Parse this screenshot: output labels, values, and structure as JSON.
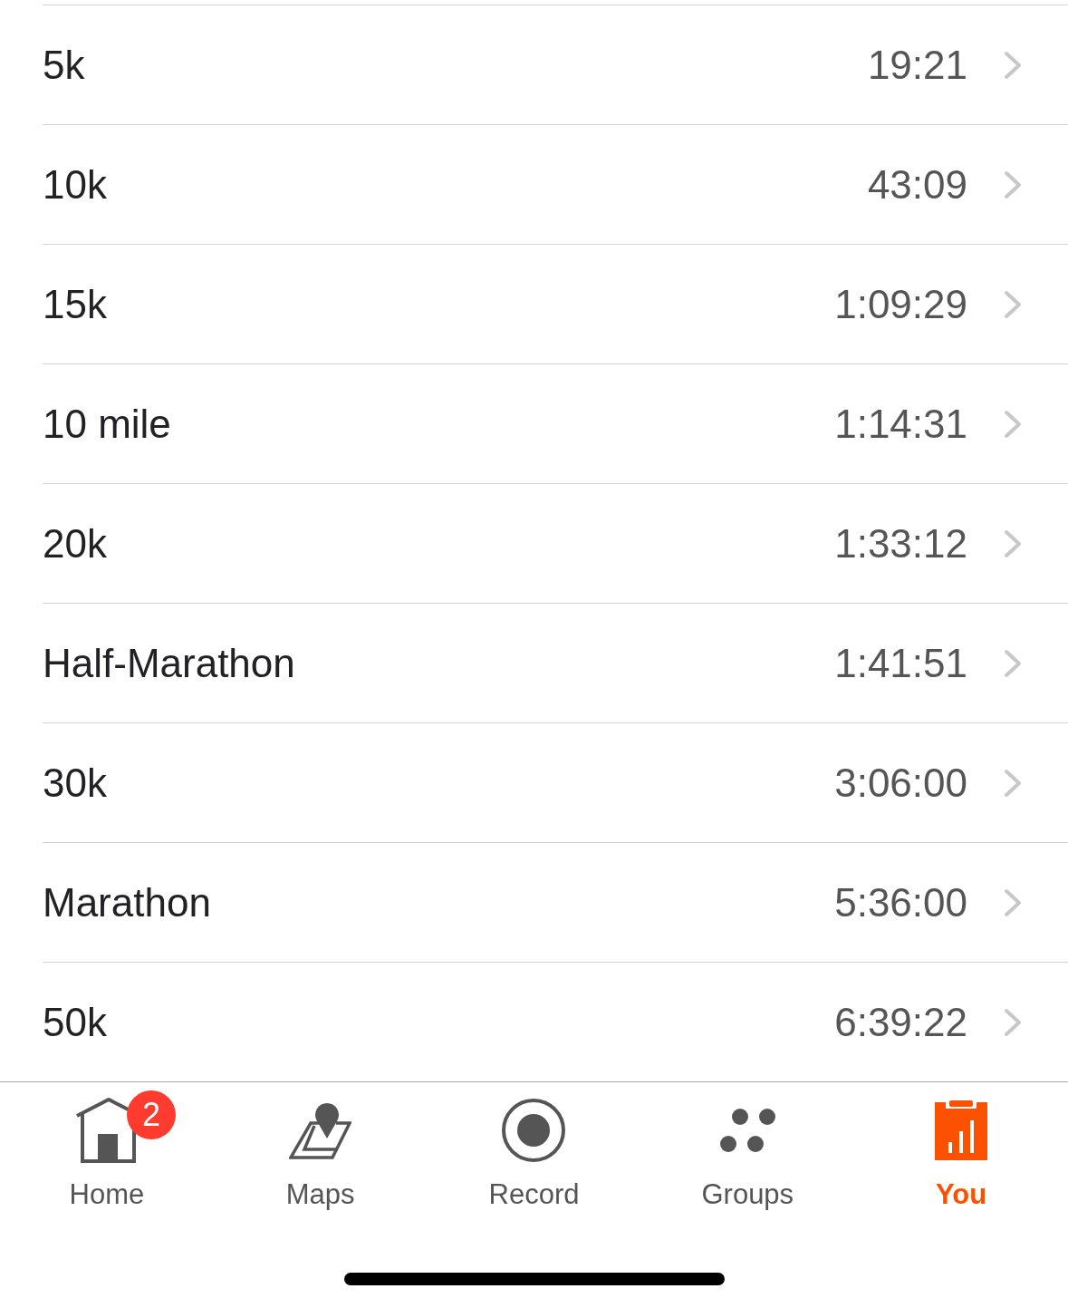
{
  "records": [
    {
      "label": "5k",
      "time": "19:21"
    },
    {
      "label": "10k",
      "time": "43:09"
    },
    {
      "label": "15k",
      "time": "1:09:29"
    },
    {
      "label": "10 mile",
      "time": "1:14:31"
    },
    {
      "label": "20k",
      "time": "1:33:12"
    },
    {
      "label": "Half-Marathon",
      "time": "1:41:51"
    },
    {
      "label": "30k",
      "time": "3:06:00"
    },
    {
      "label": "Marathon",
      "time": "5:36:00"
    },
    {
      "label": "50k",
      "time": "6:39:22"
    }
  ],
  "tab_bar": {
    "items": [
      {
        "kind": "home",
        "label": "Home",
        "selected": false,
        "badge": "2"
      },
      {
        "kind": "maps",
        "label": "Maps",
        "selected": false
      },
      {
        "kind": "record",
        "label": "Record",
        "selected": false
      },
      {
        "kind": "groups",
        "label": "Groups",
        "selected": false
      },
      {
        "kind": "you",
        "label": "You",
        "selected": true
      }
    ]
  }
}
